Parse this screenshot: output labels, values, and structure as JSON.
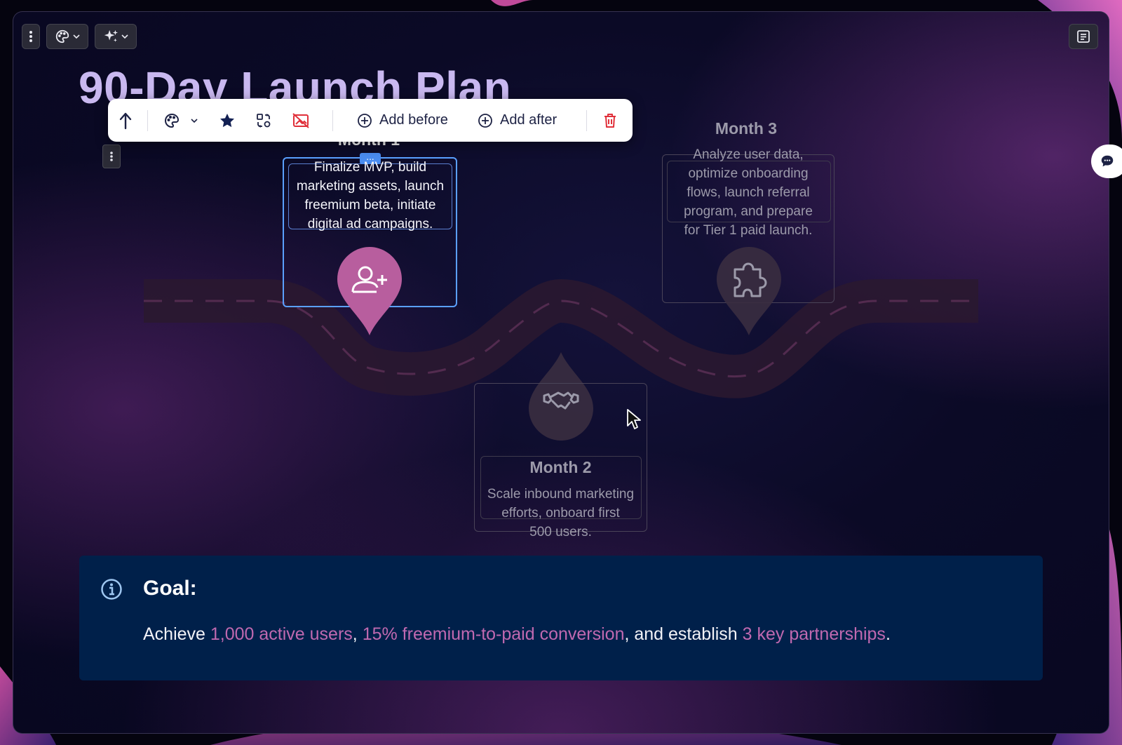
{
  "toolbar": {
    "menu_icon": "kebab-vertical-icon",
    "theme_icon": "palette-icon",
    "ai_icon": "sparkles-icon",
    "notes_icon": "notes-icon"
  },
  "page": {
    "title": "90-Day Launch Plan"
  },
  "context_toolbar": {
    "add_before_label": "Add before",
    "add_after_label": "Add after"
  },
  "cards": {
    "month1": {
      "title": "Month 1",
      "lines": [
        "Finalize MVP, build",
        "marketing assets, launch",
        "freemium beta, initiate",
        "digital ad campaigns."
      ],
      "icon": "user-plus-icon",
      "badge": "..."
    },
    "month2": {
      "title": "Month 2",
      "lines": [
        "Scale inbound marketing",
        "efforts, onboard first",
        "500 users."
      ],
      "icon": "handshake-icon"
    },
    "month3": {
      "title": "Month 3",
      "lines": [
        "Analyze user data,",
        "optimize onboarding",
        "flows, launch referral",
        "program, and prepare",
        "for Tier 1 paid launch."
      ],
      "icon": "puzzle-icon"
    }
  },
  "goal": {
    "title": "Goal:",
    "text_prefix": "Achieve ",
    "highlight1": "1,000 active users",
    "sep1": ", ",
    "highlight2": "15% freemium-to-paid conversion",
    "sep2": ", and establish ",
    "highlight3": "3 key partnerships",
    "suffix": "."
  },
  "colors": {
    "accent_pink": "#b96aa6",
    "highlight_pink": "#c069b0",
    "goal_bg": "#00204a",
    "selection_blue": "#5aa0ff",
    "delete_red": "#e0303a"
  }
}
